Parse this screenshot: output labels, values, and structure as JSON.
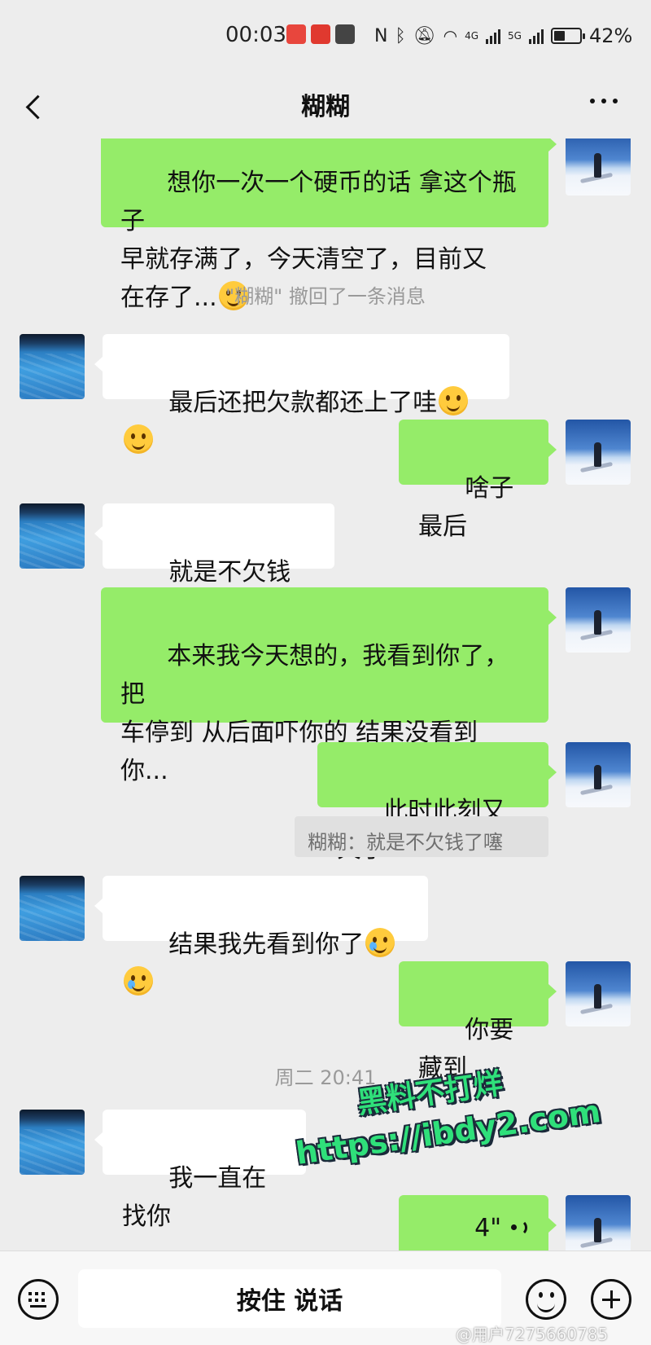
{
  "status_bar": {
    "time": "00:03",
    "network_4g": "4G",
    "network_5g": "5G",
    "battery_level": 0.42,
    "battery_pct": "42%"
  },
  "header": {
    "title": "糊糊"
  },
  "messages": [
    {
      "side": "out",
      "text": "想你一次一个硬币的话 拿这个瓶子\n早就存满了，今天清空了，目前又\n在存了..."
    },
    {
      "type": "system",
      "text": "\"糊糊\" 撤回了一条消息"
    },
    {
      "side": "in",
      "text": "最后还把欠款都还上了哇"
    },
    {
      "side": "out",
      "text": "啥子最后"
    },
    {
      "side": "in",
      "text": "就是不欠钱了噻"
    },
    {
      "side": "out",
      "text": "本来我今天想的，我看到你了，把\n车停到 从后面吓你的 结果没看到\n你..."
    },
    {
      "side": "out",
      "text": "此时此刻又欠了"
    },
    {
      "type": "quote",
      "text": "糊糊：就是不欠钱了噻"
    },
    {
      "side": "in",
      "text": "结果我先看到你了"
    },
    {
      "side": "out",
      "text": "你要藏到"
    },
    {
      "type": "timestamp",
      "text": "周二 20:41"
    },
    {
      "side": "in",
      "text": "我一直在找你"
    },
    {
      "side": "out",
      "type": "voice",
      "duration": "4\""
    }
  ],
  "watermark": {
    "line1": "黑料不打烊",
    "line2": "https://ibdy2.com"
  },
  "input_bar": {
    "hold_to_talk": "按住 说话"
  },
  "footer_watermark": "@用户7275660785"
}
